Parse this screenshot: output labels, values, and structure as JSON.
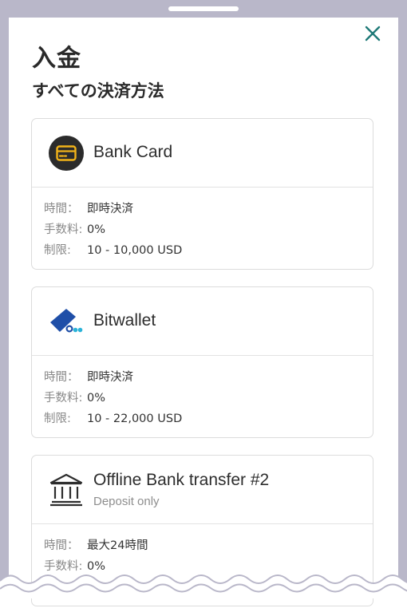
{
  "sheet": {
    "title": "入金",
    "section_title": "すべての決済方法"
  },
  "labels": {
    "time": "時間：",
    "fee": "手数料:",
    "limit": "制限:"
  },
  "methods": [
    {
      "name": "Bank Card",
      "icon": "bank-card-icon",
      "time": "即時決済",
      "fee": "0%",
      "limit": "10 - 10,000 USD"
    },
    {
      "name": "Bitwallet",
      "icon": "bitwallet-logo",
      "time": "即時決済",
      "fee": "0%",
      "limit": "10 - 22,000 USD"
    },
    {
      "name": "Offline Bank transfer #2",
      "note": "Deposit only",
      "icon": "bank-building-icon",
      "time": "最大24時間",
      "fee": "0%"
    }
  ],
  "colors": {
    "accent_close": "#1f7a78",
    "card_icon_bg": "#2b2b2b",
    "card_icon_fg": "#f2b319",
    "bitwallet_blue": "#1f4fa8",
    "bitwallet_cyan": "#2bb3d8",
    "backdrop": "#b9b7c9"
  }
}
